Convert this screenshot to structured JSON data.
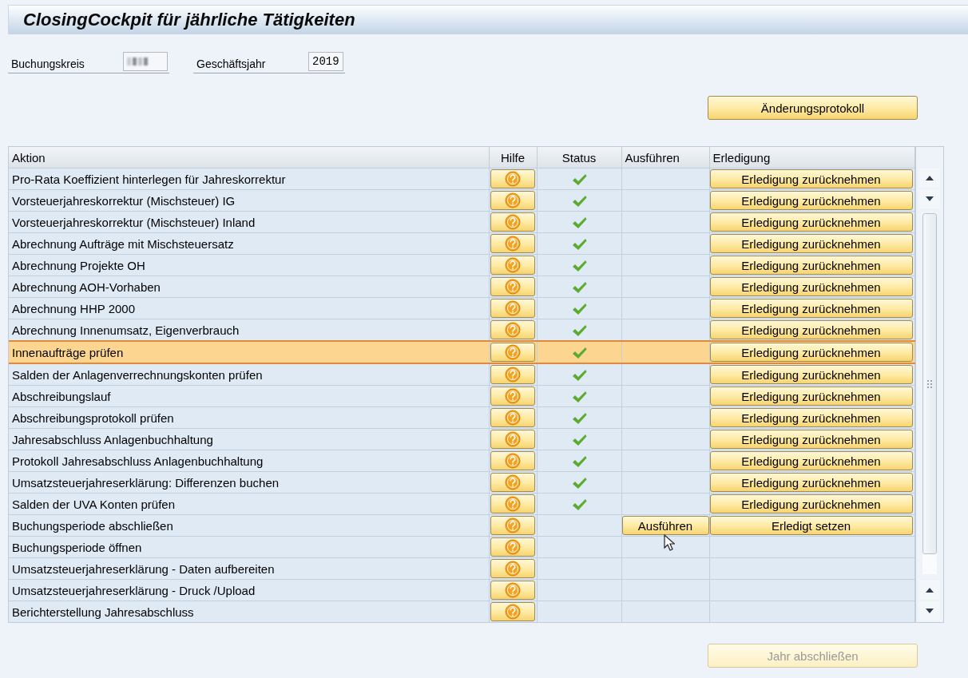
{
  "window": {
    "title": "ClosingCockpit für jährliche Tätigkeiten"
  },
  "fields": [
    {
      "label": "Buchungskreis",
      "masked": true
    },
    {
      "label": "Geschäftsjahr",
      "masked": false,
      "value": "2019"
    }
  ],
  "top_button": {
    "label": "Änderungsprotokoll",
    "disabled": false
  },
  "table": {
    "columns": [
      "Aktion",
      "Hilfe",
      "Status",
      "Ausführen",
      "Erledigung"
    ],
    "rows": [
      {
        "action": "Pro-Rata Koeffizient hinterlegen für Jahreskorrektur",
        "done": true,
        "selected": false,
        "completion": "Erledigung zurücknehmen"
      },
      {
        "action": "Vorsteuerjahreskorrektur (Mischsteuer) IG",
        "done": true,
        "selected": false,
        "completion": "Erledigung zurücknehmen"
      },
      {
        "action": "Vorsteuerjahreskorrektur (Mischsteuer) Inland",
        "done": true,
        "selected": false,
        "completion": "Erledigung zurücknehmen"
      },
      {
        "action": "Abrechnung Aufträge mit Mischsteuersatz",
        "done": true,
        "selected": false,
        "completion": "Erledigung zurücknehmen"
      },
      {
        "action": "Abrechnung Projekte OH",
        "done": true,
        "selected": false,
        "completion": "Erledigung zurücknehmen"
      },
      {
        "action": "Abrechnung AOH-Vorhaben",
        "done": true,
        "selected": false,
        "completion": "Erledigung zurücknehmen"
      },
      {
        "action": "Abrechnung HHP 2000",
        "done": true,
        "selected": false,
        "completion": "Erledigung zurücknehmen"
      },
      {
        "action": "Abrechnung Innenumsatz, Eigenverbrauch",
        "done": true,
        "selected": false,
        "completion": "Erledigung zurücknehmen"
      },
      {
        "action": "Innenaufträge prüfen",
        "done": true,
        "selected": true,
        "completion": "Erledigung zurücknehmen"
      },
      {
        "action": "Salden der Anlagenverrechnungskonten prüfen",
        "done": true,
        "selected": false,
        "completion": "Erledigung zurücknehmen"
      },
      {
        "action": "Abschreibungslauf",
        "done": true,
        "selected": false,
        "completion": "Erledigung zurücknehmen"
      },
      {
        "action": "Abschreibungsprotokoll prüfen",
        "done": true,
        "selected": false,
        "completion": "Erledigung zurücknehmen"
      },
      {
        "action": "Jahresabschluss Anlagenbuchhaltung",
        "done": true,
        "selected": false,
        "completion": "Erledigung zurücknehmen"
      },
      {
        "action": "Protokoll Jahresabschluss Anlagenbuchhaltung",
        "done": true,
        "selected": false,
        "completion": "Erledigung zurücknehmen"
      },
      {
        "action": "Umsatzsteuerjahreserklärung: Differenzen buchen",
        "done": true,
        "selected": false,
        "completion": "Erledigung zurücknehmen"
      },
      {
        "action": "Salden der UVA Konten prüfen",
        "done": true,
        "selected": false,
        "completion": "Erledigung zurücknehmen"
      },
      {
        "action": "Buchungsperiode abschließen",
        "done": false,
        "selected": false,
        "execute": "Ausführen",
        "completion": "Erledigt setzen"
      },
      {
        "action": "Buchungsperiode öffnen",
        "done": false,
        "selected": false
      },
      {
        "action": "Umsatzsteuerjahreserklärung - Daten aufbereiten",
        "done": false,
        "selected": false
      },
      {
        "action": "Umsatzsteuerjahreserklärung - Druck /Upload",
        "done": false,
        "selected": false
      },
      {
        "action": "Berichterstellung Jahresabschluss",
        "done": false,
        "selected": false
      }
    ]
  },
  "bottom_button": {
    "label": "Jahr abschließen",
    "disabled": true
  }
}
